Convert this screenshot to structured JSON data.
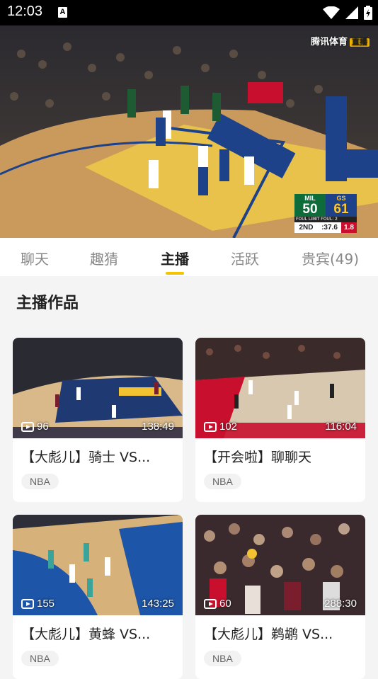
{
  "status_bar": {
    "time": "12:03",
    "notification": "A"
  },
  "video": {
    "watermark": "腾讯体育",
    "watermark_badge": "直播",
    "scorebug": {
      "team1": "MIL",
      "score1": "50",
      "team2": "GS",
      "score2": "61",
      "fouls": "FOUL LIMIT    FOUL: 2",
      "quarter": "2ND",
      "clock": ":37.6",
      "shot_clock": "1.8"
    }
  },
  "tabs": [
    {
      "label": "聊天",
      "active": false
    },
    {
      "label": "趣猜",
      "active": false
    },
    {
      "label": "主播",
      "active": true
    },
    {
      "label": "活跃",
      "active": false
    },
    {
      "label": "贵宾(49)",
      "active": false
    }
  ],
  "section_title": "主播作品",
  "videos": [
    {
      "title": "【大彪儿】骑士 VS...",
      "views": "96",
      "duration": "138:49",
      "tag": "NBA"
    },
    {
      "title": "【开会啦】聊聊天",
      "views": "102",
      "duration": "116:04",
      "tag": "NBA"
    },
    {
      "title": "【大彪儿】黄蜂 VS...",
      "views": "155",
      "duration": "143:25",
      "tag": "NBA"
    },
    {
      "title": "【大彪儿】鹈鹕 VS...",
      "views": "60",
      "duration": "288:30",
      "tag": "NBA"
    }
  ],
  "icons": {
    "wifi": "wifi-icon",
    "signal": "signal-icon",
    "battery": "battery-icon",
    "play": "play-icon"
  }
}
